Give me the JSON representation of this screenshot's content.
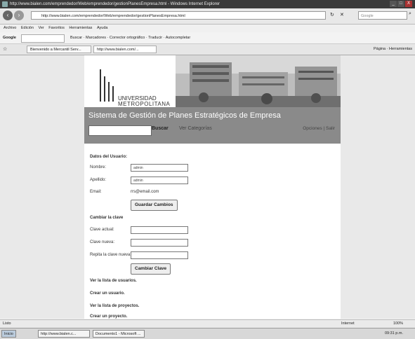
{
  "window": {
    "title": "http://www.bialen.com/emprendedor/Web/emprendedor/gestionPlanesEmpresa.html - Windows Internet Explorer",
    "minimize": "_",
    "maximize": "□",
    "close": "X"
  },
  "address": {
    "url": "http://www.bialen.com/emprendedor/Web/emprendedor/gestionPlanesEmpresa.html",
    "search_placeholder": "Google"
  },
  "menubar": [
    "Archivo",
    "Edición",
    "Ver",
    "Favoritos",
    "Herramientas",
    "Ayuda"
  ],
  "google_bar": {
    "label": "Google",
    "tools": "Buscar · Marcadores · Corrector ortográfico · Traducir · Autocompletar"
  },
  "tabs": [
    {
      "label": "Bienvenido a Mercantil Serv..."
    },
    {
      "label": "http://www.bialen.com/..."
    }
  ],
  "command_bar": "Página · Herramientas",
  "banner": {
    "logo_line1": "UNIVERSIDAD",
    "logo_line2": "METROPOLITANA"
  },
  "header": {
    "system_title": "Sistema de Gestión de Planes Estratégicos de Empresa",
    "search_button": "Buscar",
    "categories_link": "Ver Categorías",
    "options": "Opciones | Salir"
  },
  "user_data": {
    "section_title": "Datos del Usuario:",
    "name_label": "Nombre:",
    "name_value": "admin",
    "lastname_label": "Apellido:",
    "lastname_value": "admin",
    "email_label": "Email:",
    "email_value": "rrs@email.com",
    "save_button": "Guardar Cambios"
  },
  "password": {
    "section_title": "Cambiar la clave",
    "current_label": "Clave actual:",
    "new_label": "Clave nueva:",
    "repeat_label": "Repita la clave nueva:",
    "change_button": "Cambiar Clave"
  },
  "links": {
    "users_list": "Ver la lista de usuarios.",
    "create_user": "Crear un usuario.",
    "projects_list": "Ver la lista de proyectos.",
    "create_project": "Crear un proyecto."
  },
  "statusbar": {
    "left": "Listo",
    "zone": "Internet",
    "zoom": "100%"
  },
  "taskbar": {
    "start": "Inicio",
    "tasks": [
      "http://www.bialen.c...",
      "Documento1 - Microsoft ..."
    ],
    "clock": "09:31 p.m."
  }
}
